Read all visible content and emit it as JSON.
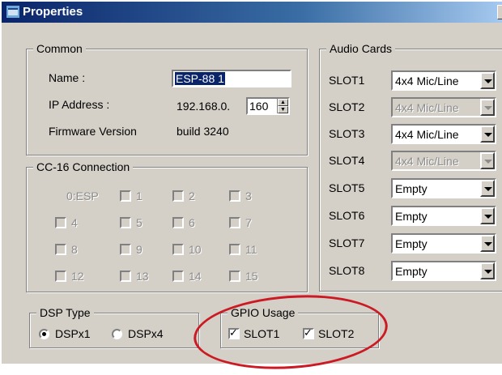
{
  "window": {
    "title": "Properties"
  },
  "common": {
    "legend": "Common",
    "name_label": "Name :",
    "name_value": "ESP-88 1",
    "ip_label": "IP Address :",
    "ip_prefix": "192.168.0.",
    "ip_last": "160",
    "fw_label": "Firmware Version",
    "fw_value": "build  3240"
  },
  "audio": {
    "legend": "Audio Cards",
    "slots": [
      {
        "label": "SLOT1",
        "value": "4x4 Mic/Line",
        "enabled": true
      },
      {
        "label": "SLOT2",
        "value": "4x4 Mic/Line",
        "enabled": false
      },
      {
        "label": "SLOT3",
        "value": "4x4 Mic/Line",
        "enabled": true
      },
      {
        "label": "SLOT4",
        "value": "4x4 Mic/Line",
        "enabled": false
      },
      {
        "label": "SLOT5",
        "value": "Empty",
        "enabled": true
      },
      {
        "label": "SLOT6",
        "value": "Empty",
        "enabled": true
      },
      {
        "label": "SLOT7",
        "value": "Empty",
        "enabled": true
      },
      {
        "label": "SLOT8",
        "value": "Empty",
        "enabled": true
      }
    ]
  },
  "cc16": {
    "legend": "CC-16 Connection",
    "first_label": "0:ESP",
    "items": [
      "1",
      "2",
      "3",
      "4",
      "5",
      "6",
      "7",
      "8",
      "9",
      "10",
      "11",
      "12",
      "13",
      "14",
      "15"
    ]
  },
  "dsp": {
    "legend": "DSP Type",
    "options": [
      "DSPx1",
      "DSPx4"
    ],
    "selected": "DSPx1"
  },
  "gpio": {
    "legend": "GPIO Usage",
    "items": [
      {
        "label": "SLOT1",
        "checked": true
      },
      {
        "label": "SLOT2",
        "checked": true
      }
    ]
  },
  "colors": {
    "annotation": "#cc1a24",
    "title_bar": "#0a246a"
  }
}
